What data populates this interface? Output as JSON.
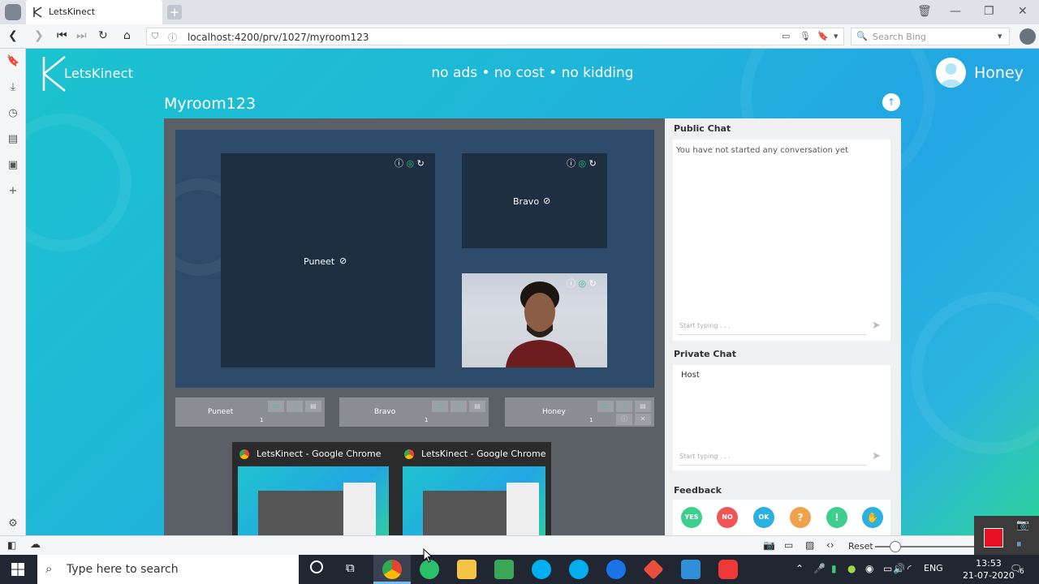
{
  "browser": {
    "tab_title": "LetsKinect",
    "url": "localhost:4200/prv/1027/myroom123",
    "search_placeholder": "Search Bing"
  },
  "page": {
    "brand": "LetsKinect",
    "tagline": "no ads • no cost • no kidding",
    "user_name": "Honey",
    "room_title": "Myroom123"
  },
  "video_tiles": [
    {
      "name": "Puneet",
      "camera": "off"
    },
    {
      "name": "Bravo",
      "camera": "off"
    },
    {
      "name": "",
      "camera": "on"
    }
  ],
  "participants": [
    {
      "name": "Puneet",
      "count": "1"
    },
    {
      "name": "Bravo",
      "count": "1"
    },
    {
      "name": "Honey",
      "count": "1"
    }
  ],
  "public_chat": {
    "title": "Public Chat",
    "empty_message": "You have not started any conversation yet",
    "input_placeholder": "Start typing . . ."
  },
  "private_chat": {
    "title": "Private Chat",
    "recipient": "Host",
    "input_placeholder": "Start typing . . ."
  },
  "feedback": {
    "title": "Feedback",
    "buttons": [
      {
        "label": "YES",
        "color": "#3ecf8e"
      },
      {
        "label": "NO",
        "color": "#f05656"
      },
      {
        "label": "OK",
        "color": "#2ab1e0"
      },
      {
        "label": "?",
        "color": "#f0a24b"
      },
      {
        "label": "!",
        "color": "#3ecf8e"
      },
      {
        "label": "✋",
        "color": "#2ab1e0"
      }
    ]
  },
  "taskbar_preview": {
    "windows": [
      "LetsKinect - Google Chrome",
      "LetsKinect - Google Chrome"
    ]
  },
  "statusbar": {
    "reset_label": "Reset"
  },
  "taskbar": {
    "search_placeholder": "Type here to search",
    "language": "ENG",
    "time": "13:53",
    "date": "21-07-2020",
    "notifications": "6"
  }
}
